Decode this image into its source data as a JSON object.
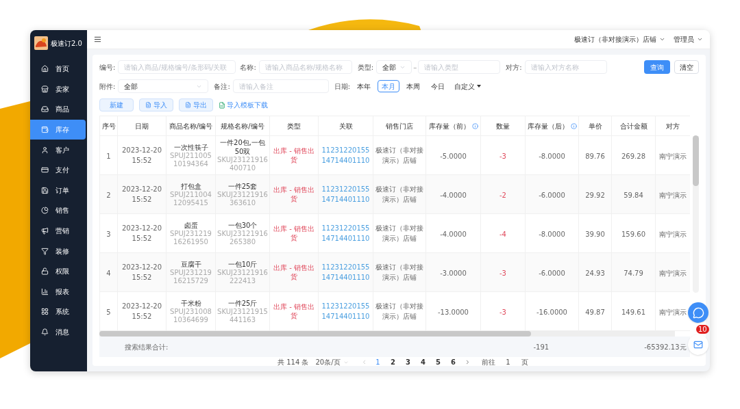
{
  "app": {
    "name": "极速订2.0"
  },
  "sidebar": {
    "items": [
      {
        "label": "首页",
        "selected": false
      },
      {
        "label": "卖家",
        "selected": false
      },
      {
        "label": "商品",
        "selected": false
      },
      {
        "label": "库存",
        "selected": true
      },
      {
        "label": "客户",
        "selected": false
      },
      {
        "label": "支付",
        "selected": false
      },
      {
        "label": "订单",
        "selected": false
      },
      {
        "label": "销售",
        "selected": false
      },
      {
        "label": "营销",
        "selected": false
      },
      {
        "label": "装修",
        "selected": false
      },
      {
        "label": "权限",
        "selected": false
      },
      {
        "label": "报表",
        "selected": false
      },
      {
        "label": "系统",
        "selected": false
      },
      {
        "label": "消息",
        "selected": false
      }
    ]
  },
  "topbar": {
    "store": "极速订（非对接演示）店铺",
    "user": "管理员"
  },
  "filters": {
    "code": {
      "label": "编号:",
      "placeholder": "请输入商品/规格编号/条形码/关联"
    },
    "name": {
      "label": "名称:",
      "placeholder": "请输入商品名称/规格名称"
    },
    "type": {
      "label": "类型:",
      "value": "全部",
      "dash": "–",
      "placeholder": "请输入类型"
    },
    "counterparty": {
      "label": "对方:",
      "placeholder": "请输入对方名称"
    },
    "attachment": {
      "label": "附件:",
      "value": "全部"
    },
    "remark": {
      "label": "备注:",
      "placeholder": "请输入备注"
    },
    "date": {
      "label": "日期:",
      "options": [
        {
          "label": "本年",
          "selected": false
        },
        {
          "label": "本月",
          "selected": true
        },
        {
          "label": "本周",
          "selected": false
        },
        {
          "label": "今日",
          "selected": false
        }
      ],
      "custom": "自定义"
    }
  },
  "actions": {
    "search": "查询",
    "clear": "清空",
    "create": "新建",
    "import": "导入",
    "export": "导出",
    "template": "导入模板下载"
  },
  "table": {
    "columns": [
      {
        "label": "序号",
        "info": false
      },
      {
        "label": "日期",
        "info": false
      },
      {
        "label": "商品名称/编号",
        "info": false
      },
      {
        "label": "规格名称/编号",
        "info": false
      },
      {
        "label": "类型",
        "info": false
      },
      {
        "label": "关联",
        "info": false
      },
      {
        "label": "销售门店",
        "info": false
      },
      {
        "label": "库存量（前）",
        "info": true
      },
      {
        "label": "数量",
        "info": false
      },
      {
        "label": "库存量（后）",
        "info": true
      },
      {
        "label": "单价",
        "info": false
      },
      {
        "label": "合计金额",
        "info": false
      },
      {
        "label": "对方",
        "info": false
      }
    ],
    "rows": [
      {
        "index": "1",
        "date": "2023-12-20 15:52",
        "product": "一次性筷子",
        "product_code": "SPUJ21100510194364",
        "spec": "一件20包,一包50双",
        "spec_code": "SKUJ23121916400710",
        "type": "出库 - 销售出货",
        "link": "1123122015514714401110",
        "store": "极速订（非对接演示）店铺",
        "stock_before": "-5.0000",
        "quantity": "-3",
        "stock_after": "-8.0000",
        "price": "89.76",
        "amount": "269.28",
        "counterparty": "南宁演示"
      },
      {
        "index": "2",
        "date": "2023-12-20 15:52",
        "product": "打包盒",
        "product_code": "SPUJ21100412095415",
        "spec": "一件25套",
        "spec_code": "SKUJ23121916363610",
        "type": "出库 - 销售出货",
        "link": "1123122015514714401110",
        "store": "极速订（非对接演示）店铺",
        "stock_before": "-4.0000",
        "quantity": "-2",
        "stock_after": "-6.0000",
        "price": "29.92",
        "amount": "59.84",
        "counterparty": "南宁演示"
      },
      {
        "index": "3",
        "date": "2023-12-20 15:52",
        "product": "卤蛋",
        "product_code": "SPUJ23121916261950",
        "spec": "一包30个",
        "spec_code": "SKUJ23121916265380",
        "type": "出库 - 销售出货",
        "link": "1123122015514714401110",
        "store": "极速订（非对接演示）店铺",
        "stock_before": "-4.0000",
        "quantity": "-4",
        "stock_after": "-8.0000",
        "price": "39.90",
        "amount": "159.60",
        "counterparty": "南宁演示"
      },
      {
        "index": "4",
        "date": "2023-12-20 15:52",
        "product": "豆腐干",
        "product_code": "SPUJ23121916215729",
        "spec": "一包10斤",
        "spec_code": "SKUJ23121916222413",
        "type": "出库 - 销售出货",
        "link": "1123122015514714401110",
        "store": "极速订（非对接演示）店铺",
        "stock_before": "-3.0000",
        "quantity": "-3",
        "stock_after": "-6.0000",
        "price": "24.93",
        "amount": "74.79",
        "counterparty": "南宁演示"
      },
      {
        "index": "5",
        "date": "2023-12-20 15:52",
        "product": "干米粉",
        "product_code": "SPUJ23100810364699",
        "spec": "一件25斤",
        "spec_code": "SKUJ23121915441163",
        "type": "出库 - 销售出货",
        "link": "1123122015514714401110",
        "store": "极速订（非对接演示）店铺",
        "stock_before": "-13.0000",
        "quantity": "-3",
        "stock_after": "-16.0000",
        "price": "49.87",
        "amount": "149.61",
        "counterparty": "南宁演示"
      }
    ],
    "summary": {
      "label": "搜索结果合计:",
      "quantity": "-191",
      "total": "-65392.13元"
    }
  },
  "pagination": {
    "total": "共 114 条",
    "page_size": "20条/页",
    "pages": [
      {
        "label": "1",
        "selected": true
      },
      {
        "label": "2",
        "selected": false
      },
      {
        "label": "3",
        "selected": false
      },
      {
        "label": "4",
        "selected": false
      },
      {
        "label": "5",
        "selected": false
      },
      {
        "label": "6",
        "selected": false
      }
    ],
    "goto_label": "前往",
    "goto_value": "1",
    "goto_suffix": "页"
  },
  "floating": {
    "badge": "10"
  }
}
